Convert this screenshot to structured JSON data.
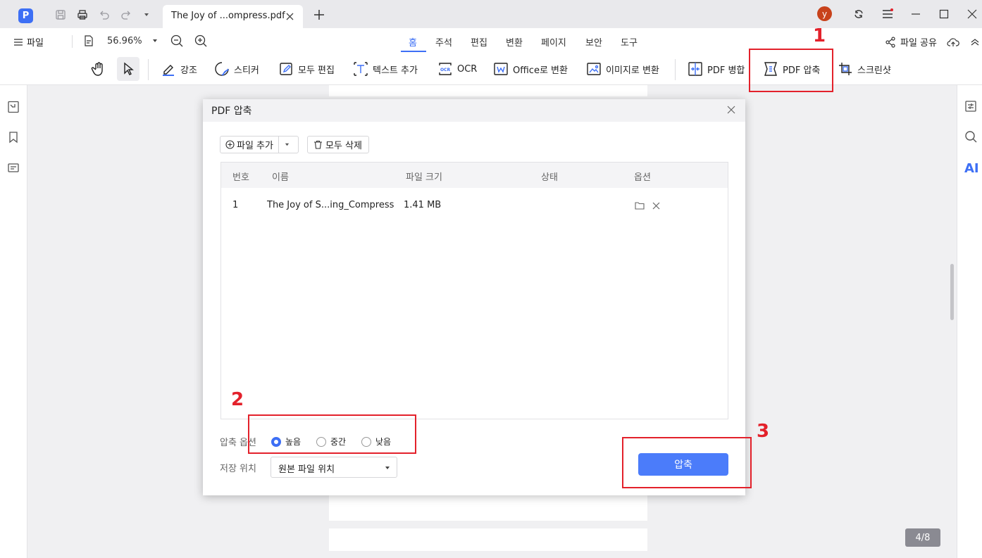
{
  "titlebar": {
    "tab_title": "The Joy of ...ompress.pdf",
    "avatar_letter": "y"
  },
  "menubar": {
    "file_label": "파일",
    "zoom_value": "56.96%",
    "tabs": [
      "홈",
      "주석",
      "편집",
      "변환",
      "페이지",
      "보안",
      "도구"
    ],
    "active_tab": "홈",
    "share_label": "파일 공유"
  },
  "toolbar": {
    "highlight": "강조",
    "sticker": "스티커",
    "edit_all": "모두 편집",
    "add_text": "텍스트 추가",
    "ocr": "OCR",
    "to_office": "Office로 변환",
    "to_image": "이미지로 변환",
    "merge": "PDF 병합",
    "compress": "PDF 압축",
    "screenshot": "스크린샷"
  },
  "right_rail": {
    "ai_label": "AI"
  },
  "dialog": {
    "title": "PDF 압축",
    "add_file_label": "파일 추가",
    "delete_all_label": "모두 삭제",
    "columns": [
      "번호",
      "이름",
      "파일 크기",
      "상태",
      "옵션"
    ],
    "rows": [
      {
        "number": "1",
        "name": "The Joy of S...ing_Compress",
        "size": "1.41 MB",
        "status": ""
      }
    ],
    "compress_option_label": "압축 옵션",
    "options": [
      {
        "label": "높음",
        "selected": true
      },
      {
        "label": "중간",
        "selected": false
      },
      {
        "label": "낮음",
        "selected": false
      }
    ],
    "save_location_label": "저장 위치",
    "save_location_value": "원본 파일 위치",
    "compress_button": "압축"
  },
  "page_indicator": "4/8",
  "annotations": [
    "1",
    "2",
    "3"
  ],
  "colors": {
    "accent": "#3d6ff5",
    "annotation": "#e3212b",
    "primary_button": "#4b7cfa"
  }
}
